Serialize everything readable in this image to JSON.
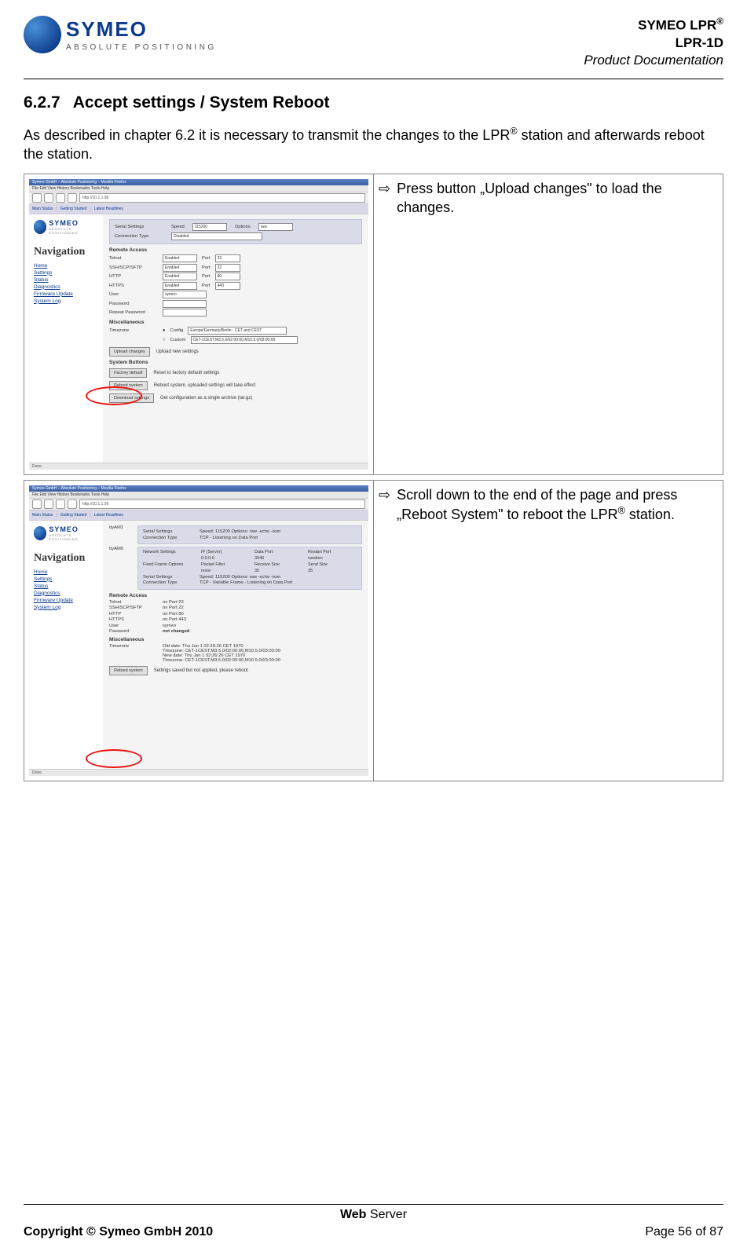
{
  "header": {
    "line1": "SYMEO LPR",
    "line1_sup": "®",
    "line2": "LPR-1D",
    "line3": "Product Documentation"
  },
  "logo": {
    "name": "SYMEO",
    "sub": "ABSOLUTE POSITIONING"
  },
  "section": {
    "number": "6.2.7",
    "title": "Accept settings / System Reboot"
  },
  "intro": {
    "pre": "As described in chapter 6.2 it is necessary to transmit the changes to the LPR",
    "sup": "®",
    "post": " station and afterwards reboot the station."
  },
  "instructions": [
    {
      "arrow": "⇨",
      "text": "Press  button „Upload changes\" to load the changes."
    },
    {
      "arrow": "⇨",
      "pre": "Scroll down to the end of the page and press „Reboot System\" to reboot the LPR",
      "sup": "®",
      "post": " station."
    }
  ],
  "mini_common": {
    "titlebar": "Symeo GmbH – Absolute Positioning – Mozilla Firefox",
    "menu": "File  Edit  View  History  Bookmarks  Tools  Help",
    "url": "http://10.1.1.96",
    "tabs": {
      "a": "Main Status",
      "b": "Getting Started",
      "c": "Latest Headlines"
    },
    "logo": "SYMEO",
    "logo_sub": "ABSOLUTE POSITIONING",
    "nav_title": "Navigation",
    "nav": [
      "Home",
      "Settings",
      "Status",
      "Diagnostics",
      "Firmware Update",
      "System Log"
    ],
    "status": "Done"
  },
  "mini1": {
    "serial_label": "Serial Settings",
    "speed_label": "Speed",
    "speed_sel": "115200",
    "options_label": "Options",
    "options_sel": "raw",
    "conn_label": "Connection Type",
    "conn_sel": "Disabled",
    "remote_heading": "Remote Access",
    "rows": [
      {
        "label": "Telnet",
        "sel": "Enabled",
        "port_label": "Port",
        "port": "23"
      },
      {
        "label": "SSH/SCP/SFTP",
        "sel": "Enabled",
        "port_label": "Port",
        "port": "22"
      },
      {
        "label": "HTTP",
        "sel": "Enabled",
        "port_label": "Port",
        "port": "80"
      },
      {
        "label": "HTTPS",
        "sel": "Enabled",
        "port_label": "Port",
        "port": "443"
      }
    ],
    "user_label": "User",
    "user_val": "symeo",
    "pw_label": "Password",
    "rpw_label": "Repeat Password",
    "misc_heading": "Miscellaneous",
    "tz_label": "Timezone",
    "config_label": "Config",
    "config_val": "Europe/Germany/Berlin - CET and CEST",
    "custom_label": "Custom",
    "custom_val": "CET-1CEST,M3.5.0/02:00:00,M10.5.0/03:00:00",
    "btn_upload": "Upload changes",
    "btn_upload_note": "Upload new settings",
    "sysbtn_heading": "System Buttons",
    "btn_factory": "Factory default",
    "btn_factory_note": "Reset to factory default settings",
    "btn_reboot": "Reboot system",
    "btn_reboot_note": "Reboot system, uploaded settings will take effect",
    "btn_download": "Download settings",
    "btn_download_note": "Get configuration as a single archive (tar.gz)"
  },
  "mini2": {
    "tty_a": "ttyAM1",
    "tty_b": "ttyAM0",
    "serial_label": "Serial Settings",
    "serial_val": "Speed: 115200 Options: raw -echo -ixon",
    "conn_label": "Connection Type",
    "conn_val_a": "TCP - Listening on Data Port",
    "net_label": "Network Settings",
    "net_cols": [
      "IP (Server)",
      "Data Port",
      "Restart Port"
    ],
    "net_vals": [
      "0.0.0.0",
      "3046",
      "random"
    ],
    "ff_label": "Fixed Frame Options",
    "ff_cols": [
      "Packet Filter",
      "Receive Size",
      "Send Size"
    ],
    "ff_vals": [
      "none",
      "35",
      "35"
    ],
    "conn_val_b": "TCP - Variable Frame - Listening on Data Port",
    "remote_heading": "Remote Access",
    "rows": [
      {
        "label": "Telnet",
        "val": "on Port 23"
      },
      {
        "label": "SSH/SCP/SFTP",
        "val": "on Port 22"
      },
      {
        "label": "HTTP",
        "val": "on Port 80"
      },
      {
        "label": "HTTPS",
        "val": "on Port 443"
      },
      {
        "label": "User",
        "val": "symeo"
      },
      {
        "label": "Password",
        "val": "not changed"
      }
    ],
    "misc_heading": "Miscellaneous",
    "tz_label": "Timezone",
    "tz_lines": [
      "Old date:  Thu Jan 1 02:26:26 CET 1970",
      "Timezone: CET-1CEST,M3.5.0/02:00:00,M10.5.0/03:00:00",
      "New date: Thu Jan 1 02:26:26 CET 1970",
      "Timezone: CET-1CEST,M3.5.0/02:00:00,M10.5.0/03:00:00"
    ],
    "btn_reboot": "Reboot system",
    "btn_reboot_note": "Settings saved but not applied, please reboot"
  },
  "footer": {
    "center_bold": "Web",
    "center_rest": " Server",
    "copyright": "Copyright © Symeo GmbH 2010",
    "page": "Page 56 of 87"
  }
}
